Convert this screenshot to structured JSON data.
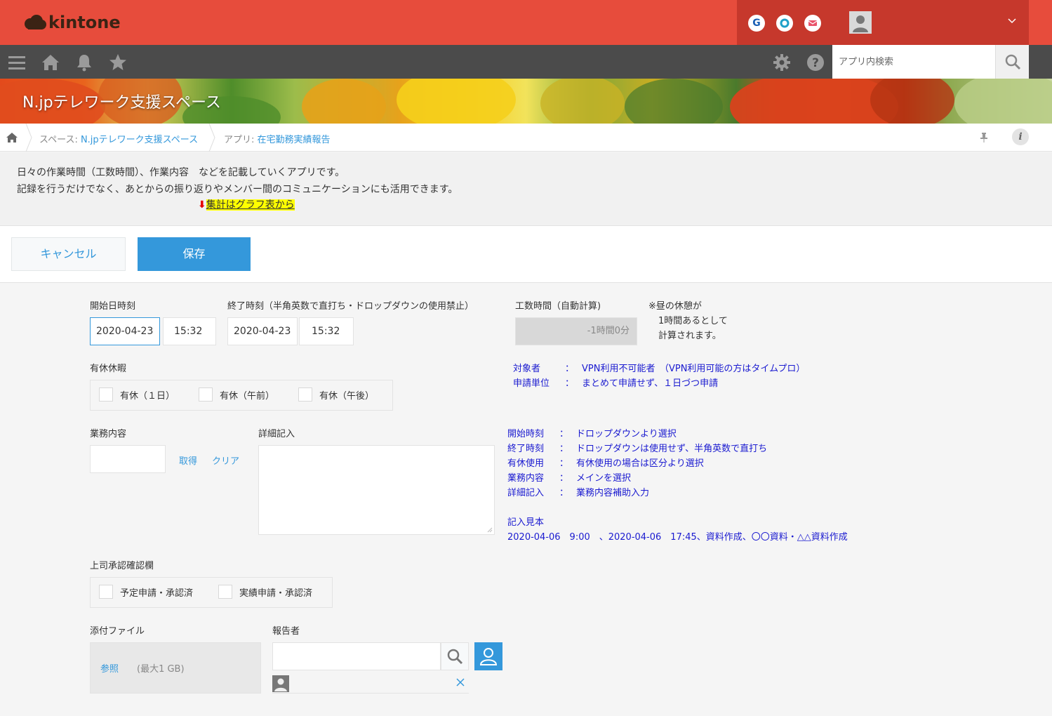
{
  "header": {
    "logo_text": "kintone",
    "apps": [
      {
        "icon": "garoon-icon",
        "glyph": "G",
        "color": "#1a5fb4"
      },
      {
        "icon": "office-icon",
        "glyph": "O",
        "color": "#1ea0c8"
      },
      {
        "icon": "mail-icon",
        "glyph": "✉",
        "color": "#e9546b"
      }
    ],
    "colors": {
      "brand": "#e74c3c",
      "brand_dark": "#c6382c",
      "nav": "#4b4b4b",
      "accent": "#3498db"
    }
  },
  "navbar": {
    "search_placeholder": "アプリ内検索"
  },
  "banner": {
    "title": "N.jpテレワーク支援スペース"
  },
  "breadcrumb": {
    "space_prefix": "スペース: ",
    "space_name": "N.jpテレワーク支援スペース",
    "app_prefix": "アプリ: ",
    "app_name": "在宅勤務実績報告",
    "info_glyph": "i"
  },
  "description": {
    "line1": "日々の作業時間（工数時間）、作業内容　などを記載していくアプリです。",
    "line2": "記録を行うだけでなく、あとからの振り返りやメンバー間のコミュニケーションにも活用できます。",
    "arrow": "⬇",
    "link_text": "集計はグラフ表から"
  },
  "toolbar": {
    "cancel_label": "キャンセル",
    "save_label": "保存"
  },
  "form": {
    "start": {
      "label": "開始日時刻",
      "date": "2020-04-23",
      "time": "15:32"
    },
    "end": {
      "label": "終了時刻（半角英数で直打ち・ドロップダウンの使用禁止）",
      "date": "2020-04-23",
      "time": "15:32"
    },
    "work_hours": {
      "label": "工数時間（自動計算)",
      "value": "-1時間0分"
    },
    "break_note": [
      "※昼の休憩が",
      "1時間あるとして",
      "計算されます。"
    ],
    "paid_leave": {
      "label": "有休休暇",
      "options": [
        "有休（１日）",
        "有休（午前）",
        "有休（午後）"
      ]
    },
    "target_notes": [
      {
        "key": "対象者",
        "sep": "：",
        "value": "VPN利用不可能者　（VPN利用可能の方はタイムプロ）"
      },
      {
        "key": "申請単位",
        "sep": "：",
        "value": "まとめて申請せず、１日づつ申請"
      }
    ],
    "work_content": {
      "label": "業務内容",
      "fetch_label": "取得",
      "clear_label": "クリア"
    },
    "detail": {
      "label": "詳細記入"
    },
    "guide_notes": [
      {
        "key": "開始時刻",
        "sep": "：",
        "value": "ドロップダウンより選択"
      },
      {
        "key": "終了時刻",
        "sep": "：",
        "value": "ドロップダウンは使用せず、半角英数で直打ち"
      },
      {
        "key": "有休使用",
        "sep": "：",
        "value": "有休使用の場合は区分より選択"
      },
      {
        "key": "業務内容",
        "sep": "：",
        "value": "メインを選択"
      },
      {
        "key": "詳細記入",
        "sep": "：",
        "value": "業務内容補助入力"
      }
    ],
    "example": {
      "title": "記入見本",
      "text": "2020-04-06　9:00　、2020-04-06　17:45、資料作成、〇〇資料・△△資料作成"
    },
    "approval": {
      "label": "上司承認確認欄",
      "options": [
        "予定申請・承認済",
        "実績申請・承認済"
      ]
    },
    "attachment": {
      "label": "添付ファイル",
      "browse_label": "参照",
      "max_label": "(最大1 GB)"
    },
    "reporter": {
      "label": "報告者"
    }
  }
}
